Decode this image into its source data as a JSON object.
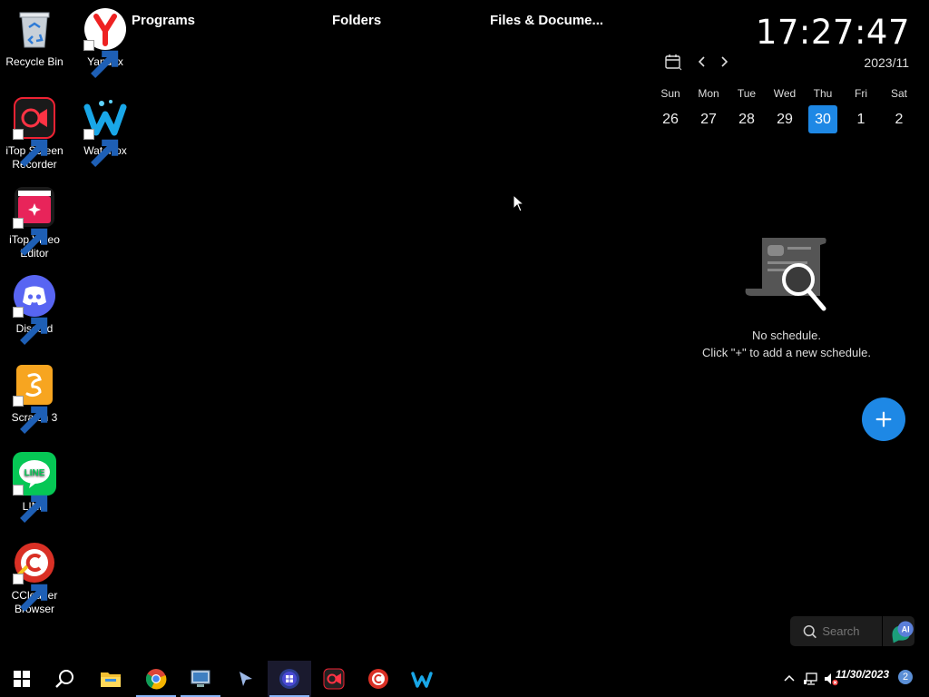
{
  "desktop_icons": [
    {
      "label": "Recycle Bin",
      "icon": "recycle-bin-icon"
    },
    {
      "label": "Yandex",
      "icon": "yandex-icon"
    },
    {
      "label": "iTop Screen Recorder",
      "icon": "itop-screen-recorder-icon"
    },
    {
      "label": "Waterfox",
      "icon": "waterfox-icon"
    },
    {
      "label": "iTop Video Editor",
      "icon": "itop-video-editor-icon"
    },
    {
      "label": "Discord",
      "icon": "discord-icon"
    },
    {
      "label": "Scratch 3",
      "icon": "scratch-icon"
    },
    {
      "label": "LINE",
      "icon": "line-icon"
    },
    {
      "label": "CCleaner Browser",
      "icon": "ccleaner-browser-icon"
    }
  ],
  "sections": {
    "programs": "Programs",
    "folders": "Folders",
    "files": "Files & Docume..."
  },
  "clock": {
    "time": "17:27:47"
  },
  "calendar": {
    "year_month": "2023/11",
    "weekdays": [
      "Sun",
      "Mon",
      "Tue",
      "Wed",
      "Thu",
      "Fri",
      "Sat"
    ],
    "days": [
      "26",
      "27",
      "28",
      "29",
      "30",
      "1",
      "2"
    ],
    "today": "30"
  },
  "schedule": {
    "empty_title": "No schedule.",
    "empty_hint": "Click \"+\" to add a new schedule."
  },
  "search": {
    "placeholder": "Search",
    "ai_label": "AI"
  },
  "taskbar": {
    "items": [
      "start-icon",
      "search-icon",
      "file-explorer-icon",
      "chrome-icon",
      "remote-desktop-icon",
      "cursor-app-icon",
      "ms-store-icon",
      "itop-screen-recorder-icon",
      "ccleaner-browser-icon",
      "waterfox-icon"
    ],
    "date": "11/30/2023",
    "notification_count": "2"
  },
  "colors": {
    "accent": "#1e88e5",
    "background": "#000000"
  }
}
